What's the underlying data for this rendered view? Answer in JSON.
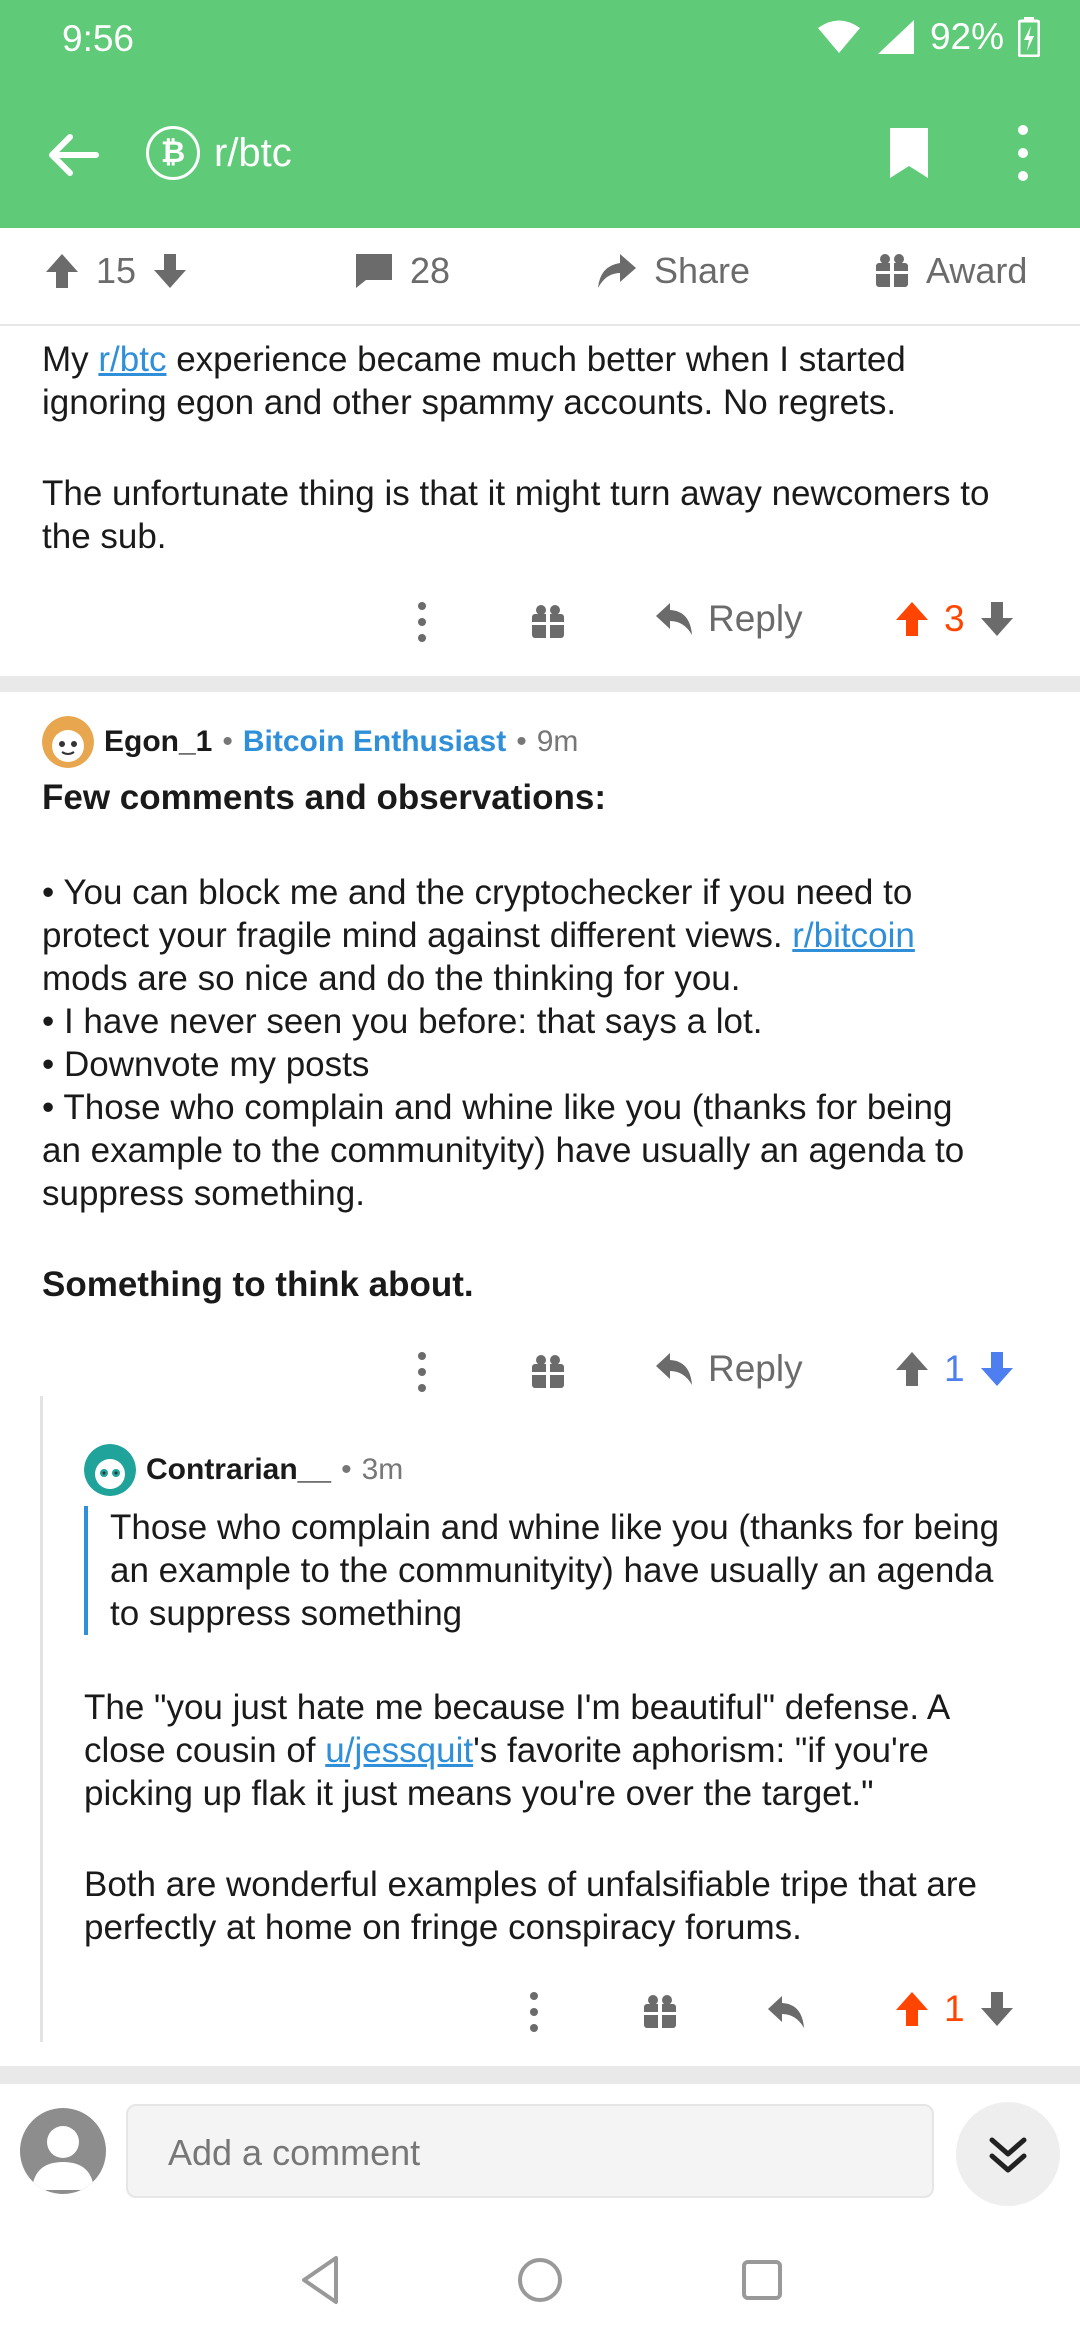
{
  "status_bar": {
    "time": "9:56",
    "battery": "92%"
  },
  "app_bar": {
    "subreddit": "r/btc",
    "badge_symbol": "₿"
  },
  "post_actions": {
    "upvotes": "15",
    "comments": "28",
    "share": "Share",
    "award": "Award"
  },
  "comment1": {
    "line1_pre": "My ",
    "line1_link": "r/btc",
    "line1_post": " experience became much better when I started",
    "line2": "ignoring egon and other spammy accounts. No regrets.",
    "line3": "The unfortunate thing is that it might turn away newcomers to",
    "line4": "the sub.",
    "reply": "Reply",
    "score": "3"
  },
  "comment2": {
    "author": "Egon_1",
    "flair": "Bitcoin Enthusiast",
    "age": "9m",
    "heading": "Few comments and observations:",
    "b1_l1": "• You can block me and the cryptochecker if you need to",
    "b1_l2_pre": "protect your fragile mind against different views. ",
    "b1_l2_link": "r/bitcoin",
    "b1_l3": "mods are so nice and do the thinking for you.",
    "b2": "• I have never seen you before: that says a lot.",
    "b3": "• Downvote my posts",
    "b4_l1": "• Those who complain and whine like you (thanks for being",
    "b4_l2": "an example to the communityity) have usually an agenda to",
    "b4_l3": "suppress something.",
    "closing": "Something to think about.",
    "reply": "Reply",
    "score": "1"
  },
  "comment3": {
    "author": "Contrarian__",
    "age": "3m",
    "quote_l1": "Those who complain and whine like you (thanks for being",
    "quote_l2": "an example to the communityity) have usually an agenda",
    "quote_l3": "to suppress something",
    "p1_l1": "The \"you just hate me because I'm beautiful\" defense. A",
    "p1_l2_pre": "close cousin of ",
    "p1_l2_link": "u/jessquit",
    "p1_l2_post": "'s favorite aphorism: \"if you're",
    "p1_l3": "picking up flak it just means you're over the target.\"",
    "p2_l1": "Both are wonderful examples of unfalsifiable tripe that are",
    "p2_l2": "perfectly at home on fringe conspiracy forums.",
    "score": "1"
  },
  "comment_bar": {
    "placeholder": "Add a comment"
  },
  "colors": {
    "brand_green": "#5fcb78",
    "upvote_orange": "#ff4500",
    "downvote_blue": "#4d7ff0",
    "link_blue": "#2f8fd8"
  }
}
